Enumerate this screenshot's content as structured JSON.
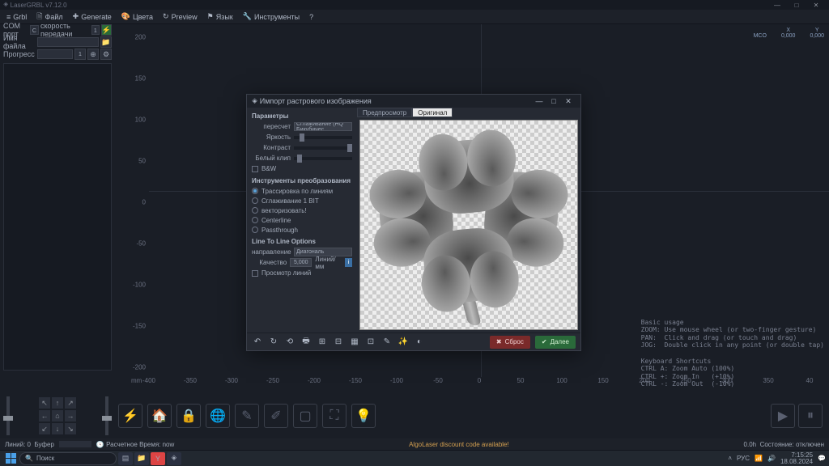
{
  "app": {
    "title": "LaserGRBL v7.12.0"
  },
  "win_buttons": {
    "min": "—",
    "max": "□",
    "close": "✕"
  },
  "menu": [
    {
      "icon": "≡",
      "label": "Grbl"
    },
    {
      "icon": "🗎",
      "label": "Файл"
    },
    {
      "icon": "✚",
      "label": "Generate"
    },
    {
      "icon": "🎨",
      "label": "Цвета"
    },
    {
      "icon": "↻",
      "label": "Preview"
    },
    {
      "icon": "⚑",
      "label": "Язык"
    },
    {
      "icon": "🔧",
      "label": "Инструменты"
    },
    {
      "icon": "?",
      "label": ""
    }
  ],
  "topleft": {
    "com_label": "COM порт",
    "com_value": "C",
    "baud_label": "скорость передачи",
    "baud_value": "1",
    "file_label": "Имя файла",
    "prog_label": "Прогресс",
    "prog_value": "1"
  },
  "coords": {
    "x_hdr": "X",
    "y_hdr": "Y",
    "mco": "MCO",
    "x": "0,000",
    "y": "0,000"
  },
  "ruler_y": [
    "200",
    "150",
    "100",
    "50",
    "0",
    "-50",
    "-100",
    "-150",
    "-200"
  ],
  "ruler_x": [
    "-400",
    "-350",
    "-300",
    "-250",
    "-200",
    "-150",
    "-100",
    "-50",
    "0",
    "50",
    "100",
    "150",
    "200",
    "250",
    "300",
    "350",
    "40"
  ],
  "ruler_unit": "mm",
  "help": "Basic usage\nZOOM: Use mouse wheel (or two-finger gesture)\nPAN:  Click and drag (or touch and drag)\nJOG:  Double click in any point (or double tap)\n\nKeyboard Shortcuts\nCTRL A: Zoom Auto (100%)\nCTRL +: Zoom In   (+10%)\nCTRL -: Zoom Out  (-10%)",
  "dialog": {
    "title": "Импорт растрового изображения",
    "params_hdr": "Параметры",
    "resample_lbl": "пересчет",
    "resample_val": "Сглаживание (HQ Бикубичес",
    "brightness_lbl": "Яркость",
    "contrast_lbl": "Контраст",
    "whiteclip_lbl": "Белый клип",
    "bw_lbl": "B&W",
    "tools_hdr": "Инструменты преобразования",
    "r_trace": "Трассировка по линиям",
    "r_dither": "Сглаживание 1 BIT",
    "r_vector": "векторизовать!",
    "r_center": "Centerline",
    "r_pass": "Passthrough",
    "line_hdr": "Line To Line Options",
    "dir_lbl": "направление",
    "dir_val": "Диагональ",
    "quality_lbl": "Качество",
    "quality_val": "5,000",
    "quality_unit": "Линий/мм",
    "preview_lbl": "Просмотр линий",
    "tab_preview": "Предпросмотр",
    "tab_original": "Оригинал",
    "toolbar": [
      "↶",
      "↻",
      "⟲",
      "🖶",
      "⊞",
      "⊟",
      "▦",
      "⊡",
      "✎",
      "✨",
      "◐"
    ],
    "reset": "Сброс",
    "next": "Далее"
  },
  "bottom_icons": [
    "⚡",
    "🏠",
    "🔒",
    "🌐",
    "✎",
    "✐",
    "▢",
    "⛶",
    "💡"
  ],
  "play_icons": [
    "▶",
    "⏸"
  ],
  "status": {
    "lines_lbl": "Линий: 0",
    "buffer_lbl": "Буфер",
    "est_lbl": "Расчетное Время:",
    "est_val": "now",
    "promo": "AlgoLaser discount code available!",
    "right_time": "0.0h",
    "state": "Состояние: отключен"
  },
  "taskbar": {
    "search_ph": "Поиск",
    "lang": "РУС",
    "time": "7:15:25",
    "date": "18.08.2024"
  },
  "chart_data": null
}
